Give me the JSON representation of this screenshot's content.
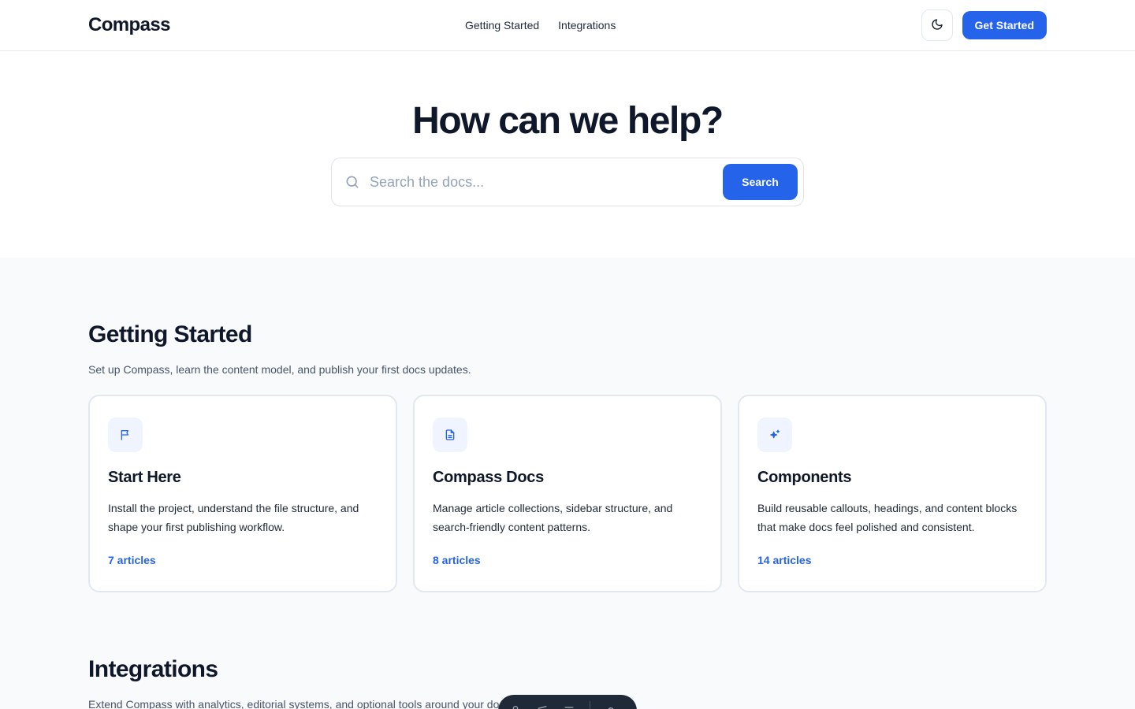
{
  "header": {
    "logo": "Compass",
    "nav": [
      {
        "label": "Getting Started"
      },
      {
        "label": "Integrations"
      }
    ],
    "theme_icon": "moon-icon",
    "cta_label": "Get Started"
  },
  "hero": {
    "title": "How can we help?",
    "search_placeholder": "Search the docs...",
    "search_value": "",
    "search_button": "Search"
  },
  "sections": [
    {
      "title": "Getting Started",
      "description": "Set up Compass, learn the content model, and publish your first docs updates.",
      "cards": [
        {
          "icon": "flag-icon",
          "title": "Start Here",
          "body": "Install the project, understand the file structure, and shape your first publishing workflow.",
          "count": "7 articles"
        },
        {
          "icon": "document-icon",
          "title": "Compass Docs",
          "body": "Manage article collections, sidebar structure, and search-friendly content patterns.",
          "count": "8 articles"
        },
        {
          "icon": "sparkles-icon",
          "title": "Components",
          "body": "Build reusable callouts, headings, and content blocks that make docs feel polished and consistent.",
          "count": "14 articles"
        }
      ]
    },
    {
      "title": "Integrations",
      "description": "Extend Compass with analytics, editorial systems, and optional tools around your docs workflow."
    }
  ],
  "colors": {
    "accent": "#2563eb",
    "text": "#0f172a",
    "muted": "#475569",
    "section_bg": "#f8fafc",
    "card_border": "#e2e8f0"
  }
}
